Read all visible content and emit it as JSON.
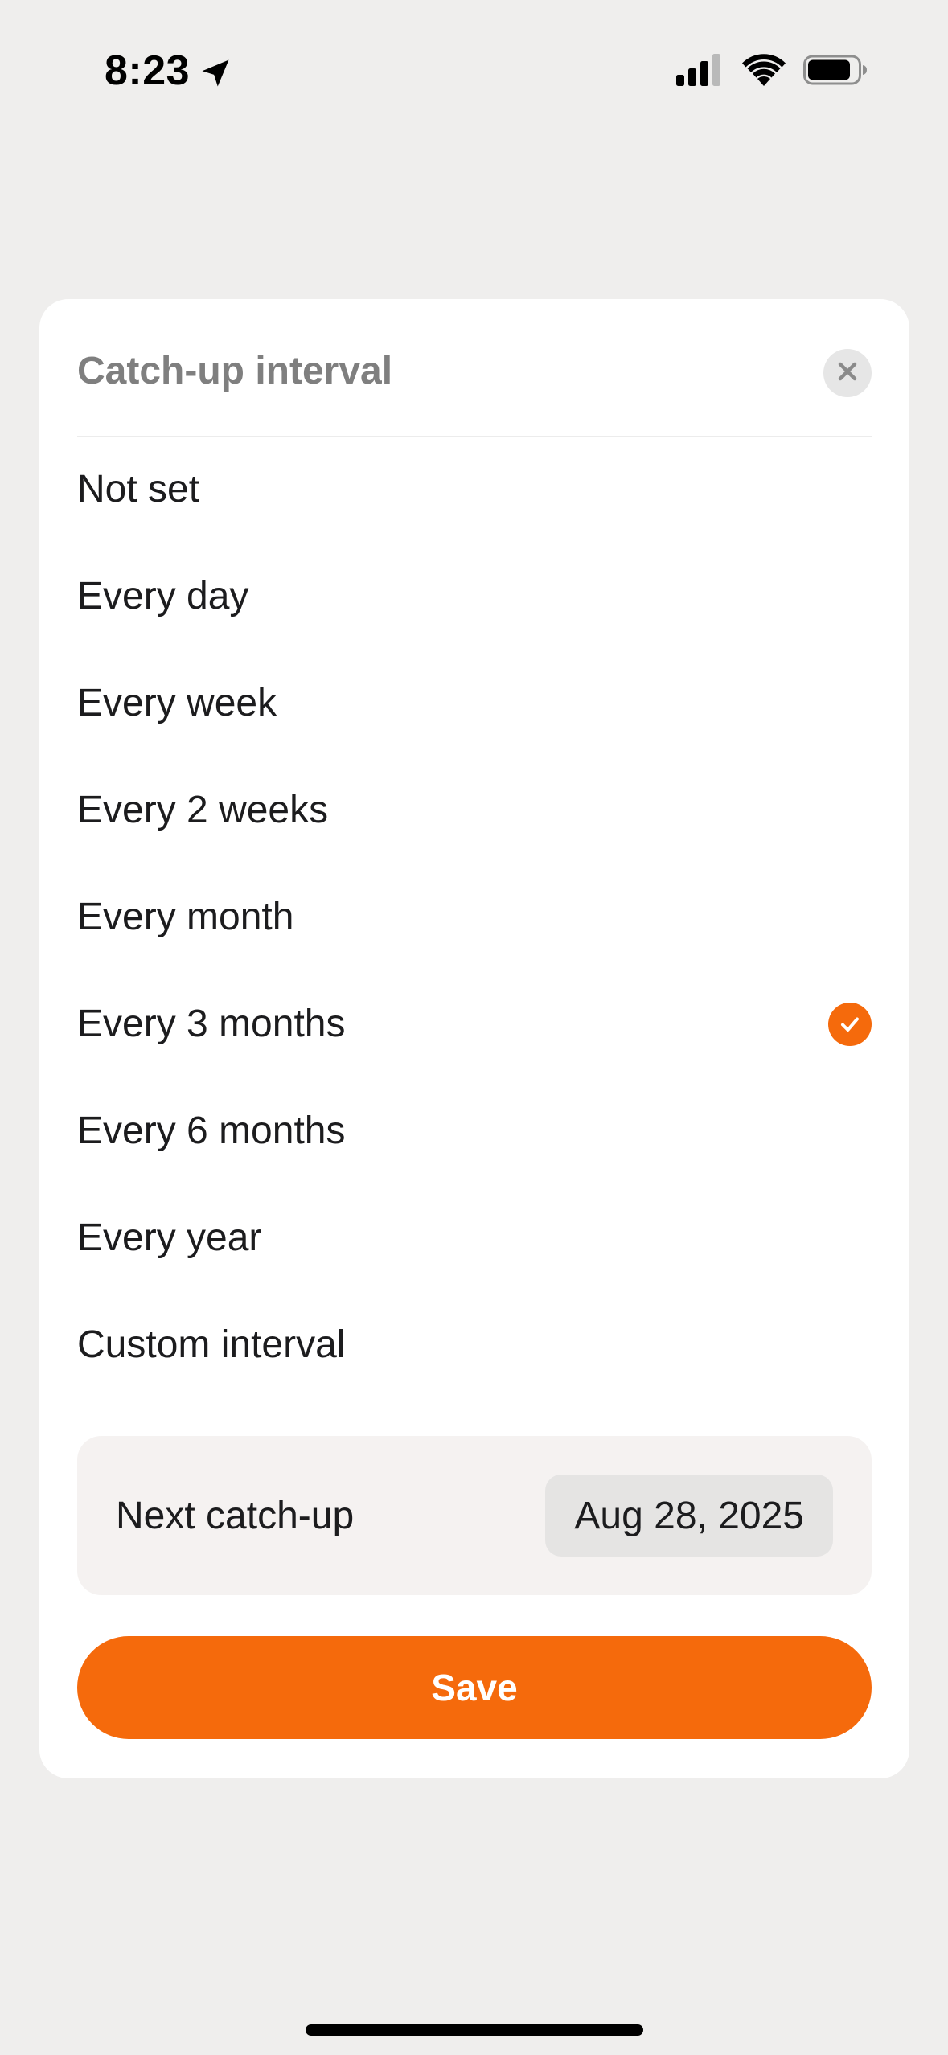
{
  "status_bar": {
    "time": "8:23",
    "location_icon": "location-arrow-icon",
    "signal_icon": "cellular-signal-icon",
    "wifi_icon": "wifi-icon",
    "battery_icon": "battery-icon"
  },
  "sheet": {
    "title": "Catch-up interval",
    "close_icon": "close-icon",
    "options": [
      {
        "label": "Not set",
        "selected": false
      },
      {
        "label": "Every day",
        "selected": false
      },
      {
        "label": "Every week",
        "selected": false
      },
      {
        "label": "Every 2 weeks",
        "selected": false
      },
      {
        "label": "Every month",
        "selected": false
      },
      {
        "label": "Every 3 months",
        "selected": true
      },
      {
        "label": "Every 6 months",
        "selected": false
      },
      {
        "label": "Every year",
        "selected": false
      },
      {
        "label": "Custom interval",
        "selected": false
      }
    ],
    "next_catchup": {
      "label": "Next catch-up",
      "date": "Aug 28, 2025"
    },
    "save_label": "Save"
  },
  "colors": {
    "accent": "#f56a0c",
    "background": "#efeeed",
    "sheet": "#ffffff",
    "title_gray": "#7f7f7f"
  }
}
